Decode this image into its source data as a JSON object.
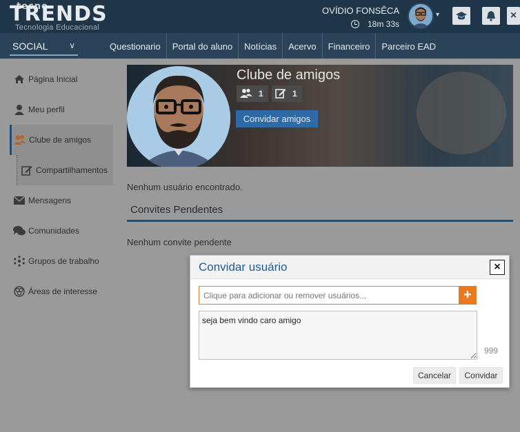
{
  "header": {
    "logo_top": "tecno",
    "logo_main": "TRENDS",
    "logo_sub": "Tecnologia Educacional",
    "user_name": "OVÍDIO FONSÊCA",
    "timer": "18m 33s"
  },
  "nav": {
    "social_label": "SOCIAL",
    "links": [
      "Questionario",
      "Portal do aluno",
      "Notícias",
      "Acervo",
      "Financeiro",
      "Parceiro EAD"
    ]
  },
  "sidebar": {
    "items": [
      {
        "label": "Página Inicial",
        "icon": "home-icon"
      },
      {
        "label": "Meu perfil",
        "icon": "user-icon"
      },
      {
        "label": "Clube de amigos",
        "icon": "friends-icon"
      },
      {
        "label": "Compartilhamentos",
        "icon": "edit-icon"
      },
      {
        "label": "Mensagens",
        "icon": "envelope-icon"
      },
      {
        "label": "Comunidades",
        "icon": "chat-icon"
      },
      {
        "label": "Grupos de trabalho",
        "icon": "network-icon"
      },
      {
        "label": "Áreas de interesse",
        "icon": "interests-icon"
      }
    ]
  },
  "club": {
    "title": "Clube de amigos",
    "friends_count": "1",
    "shares_count": "1",
    "invite_button": "Convidar amigos"
  },
  "content": {
    "no_users": "Nenhum usuário encontrado.",
    "pending_title": "Convites Pendentes",
    "no_invites": "Nenhum convite pendente"
  },
  "modal": {
    "title": "Convidar usuário",
    "close": "×",
    "user_placeholder": "Clique para adicionar ou remover usuários...",
    "message": "seja bem vindo caro amigo",
    "counter": "999",
    "cancel": "Cancelar",
    "invite": "Convidar"
  }
}
